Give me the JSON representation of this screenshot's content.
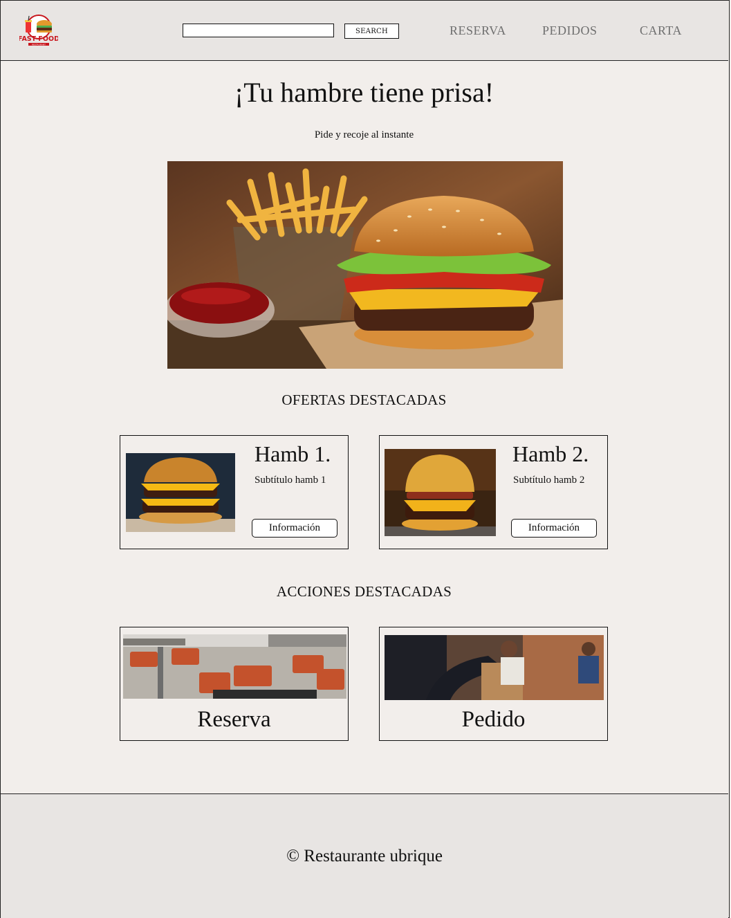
{
  "header": {
    "logo": {
      "icon": "fast-food-logo-icon",
      "brand_text": "FAST FOOD",
      "tagline": "RESTAURANT"
    },
    "search": {
      "placeholder": "",
      "value": "",
      "button_label": "SEARCH"
    },
    "nav": [
      {
        "label": "RESERVA"
      },
      {
        "label": "PEDIDOS"
      },
      {
        "label": "CARTA"
      }
    ]
  },
  "hero": {
    "title": "¡Tu hambre tiene prisa!",
    "subtitle": "Pide y recoje al instante",
    "image": "burger-and-fries-photo"
  },
  "offers": {
    "heading": "OFERTAS DESTACADAS",
    "items": [
      {
        "title": "Hamb 1.",
        "subtitle": "Subtítulo hamb 1",
        "button_label": "Información",
        "image": "double-cheeseburger-photo"
      },
      {
        "title": "Hamb 2.",
        "subtitle": "Subtítulo hamb 2",
        "button_label": "Información",
        "image": "bacon-cheeseburger-photo"
      }
    ]
  },
  "actions": {
    "heading": "ACCIONES DESTACADAS",
    "items": [
      {
        "label": "Reserva",
        "image": "restaurant-tables-photo"
      },
      {
        "label": "Pedido",
        "image": "takeaway-order-photo"
      }
    ]
  },
  "footer": {
    "text": "© Restaurante ubrique"
  },
  "colors": {
    "page_bg": "#f2eeeb",
    "header_bg": "#e8e5e3",
    "nav_text": "#6f6f6f",
    "brand_red": "#c8161d"
  }
}
